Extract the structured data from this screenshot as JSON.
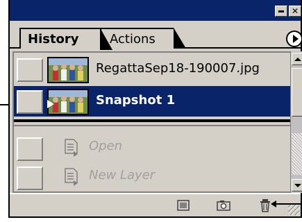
{
  "panel": {
    "tabs": [
      {
        "label": "History",
        "active": true
      },
      {
        "label": "Actions",
        "active": false
      }
    ],
    "titlebar_buttons": {
      "minimize": "minimize",
      "close": "✕"
    }
  },
  "history": {
    "snapshots": [
      {
        "label": "RegattaSep18-190007.jpg",
        "selected": false
      },
      {
        "label": "Snapshot 1",
        "selected": true
      }
    ],
    "states": [
      {
        "label": "Open",
        "dimmed": true
      },
      {
        "label": "New Layer",
        "dimmed": true
      }
    ]
  },
  "toolbar": {
    "buttons": [
      "new-document-from-state",
      "create-new-snapshot",
      "delete-current-state"
    ]
  },
  "colors": {
    "titlebar": "#0a246a",
    "selection": "#0a246a",
    "panel_bg": "#d4d0c8"
  }
}
